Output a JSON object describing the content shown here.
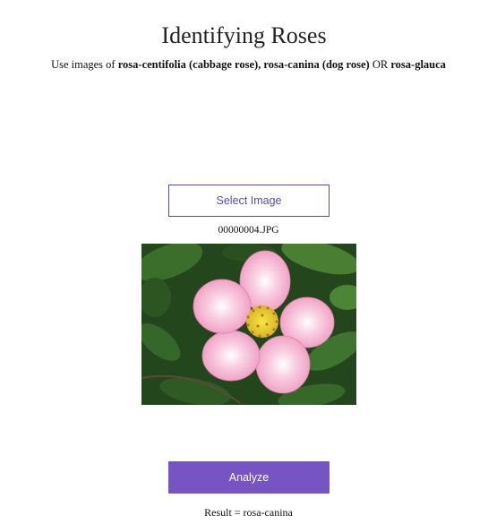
{
  "page": {
    "title": "Identifying Roses"
  },
  "instructions": {
    "prefix": "Use images of ",
    "species_1": "rosa-centifolia (cabbage rose), rosa-canina (dog rose)",
    "separator": " OR ",
    "species_2": "rosa-glauca"
  },
  "upload": {
    "select_label": "Select Image",
    "filename": "00000004.JPG"
  },
  "preview": {
    "subject": "pink dog rose flower on green leaves"
  },
  "actions": {
    "analyze_label": "Analyze"
  },
  "result": {
    "text": "Result = rosa-canina"
  },
  "colors": {
    "accent": "#7654c4",
    "select_border": "#5b4aa8",
    "petal": "#f2a9c8",
    "foliage": "#2e5a22"
  }
}
